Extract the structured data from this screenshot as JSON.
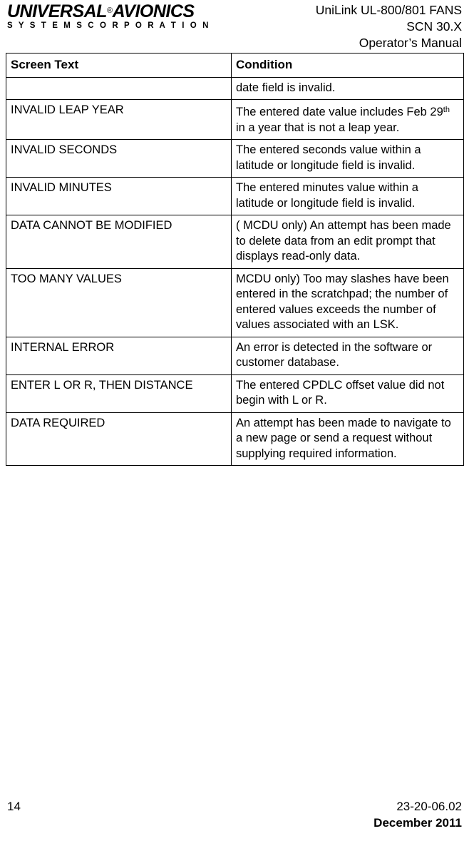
{
  "header": {
    "logo_main": "UNIVERSAL",
    "logo_main_accent": "AVIONICS",
    "logo_registered": "®",
    "logo_sub": "S Y S T E M S   C O R P O R A T I O N",
    "line1": "UniLink UL-800/801 FANS",
    "line2": "SCN 30.X",
    "line3": "Operator’s Manual"
  },
  "table": {
    "columns": [
      "Screen Text",
      "Condition"
    ],
    "rows": [
      {
        "screen_text": "",
        "condition": "date field is invalid."
      },
      {
        "screen_text": "INVALID LEAP YEAR",
        "condition_pre": "The entered date value includes Feb 29",
        "condition_sup": "th",
        "condition_post": " in a year that is not a leap year."
      },
      {
        "screen_text": "INVALID SECONDS",
        "condition": "The entered seconds value within a latitude or longitude field is invalid."
      },
      {
        "screen_text": "INVALID MINUTES",
        "condition": "The entered minutes value within a latitude or longitude field is invalid."
      },
      {
        "screen_text": "DATA CANNOT BE MODIFIED",
        "condition": "( MCDU only) An attempt has been made to delete data from an edit prompt that displays read-only data."
      },
      {
        "screen_text": "TOO MANY VALUES",
        "condition": "MCDU only) Too may slashes have been entered in the scratchpad; the number of entered values exceeds the number of values associated with an LSK."
      },
      {
        "screen_text": "INTERNAL ERROR",
        "condition": "An error is detected in the software or customer database."
      },
      {
        "screen_text": "ENTER L OR R, THEN DISTANCE",
        "condition": "The entered CPDLC offset value did not begin with L or R."
      },
      {
        "screen_text": "DATA REQUIRED",
        "condition": "An attempt has been made to navigate to a new page or send a request without supplying required information."
      }
    ]
  },
  "footer": {
    "page_number": "14",
    "document_number": "23-20-06.02",
    "date": "December 2011"
  }
}
